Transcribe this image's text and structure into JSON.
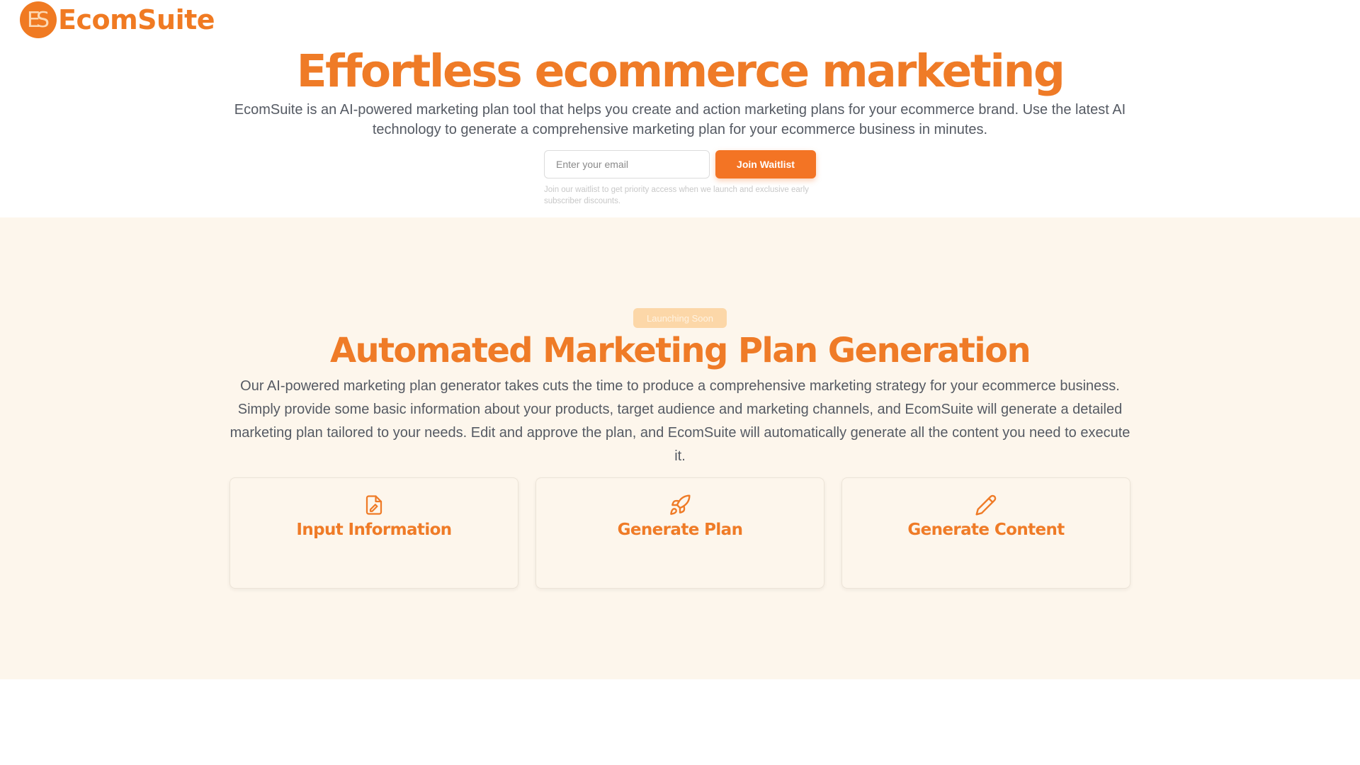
{
  "brand": {
    "logo_initials": "ES",
    "name": "EcomSuite",
    "accent_color": "#ef7b27"
  },
  "hero": {
    "title": "Effortless ecommerce marketing",
    "description": "EcomSuite is an AI-powered marketing plan tool that helps you create and action marketing plans for your ecommerce brand. Use the latest AI technology to generate a comprehensive marketing plan for your ecommerce business in minutes.",
    "email_placeholder": "Enter your email",
    "join_button": "Join Waitlist",
    "note": "Join our waitlist to get priority access when we launch and exclusive early subscriber discounts."
  },
  "features": {
    "badge": "Launching Soon",
    "title": "Automated Marketing Plan Generation",
    "description": "Our AI-powered marketing plan generator takes cuts the time to produce a comprehensive marketing strategy for your ecommerce business. Simply provide some basic information about your products, target audience and marketing channels, and EcomSuite will generate a detailed marketing plan tailored to your needs. Edit and approve the plan, and EcomSuite will automatically generate all the content you need to execute it.",
    "cards": [
      {
        "icon": "file-edit-icon",
        "title": "Input Information",
        "description": ""
      },
      {
        "icon": "rocket-icon",
        "title": "Generate Plan",
        "description": ""
      },
      {
        "icon": "pencil-icon",
        "title": "Generate Content",
        "description": ""
      }
    ]
  }
}
